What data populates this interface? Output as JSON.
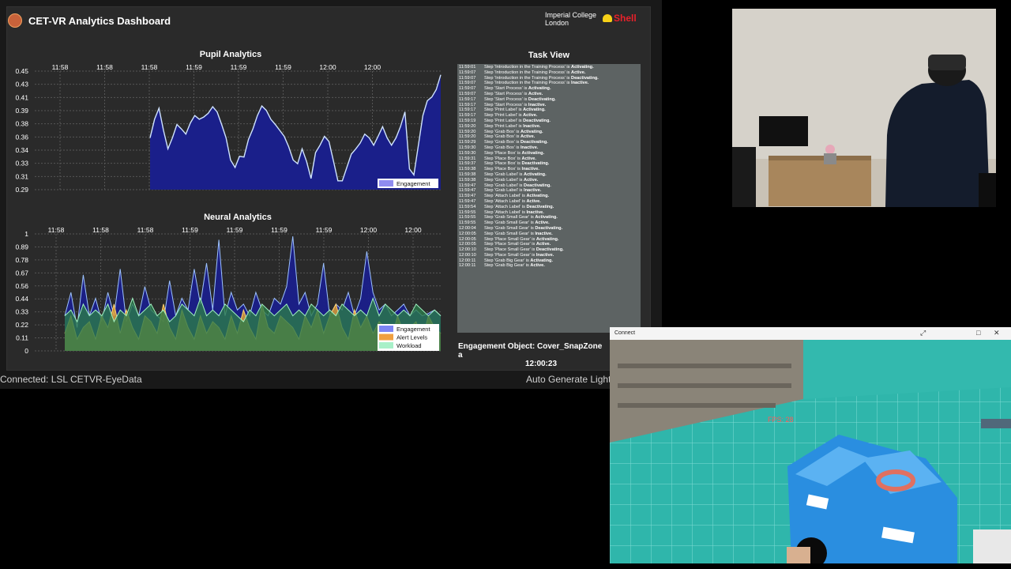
{
  "dashboard": {
    "title": "CET-VR Analytics Dashboard",
    "brand_1_line1": "Imperial College",
    "brand_1_line2": "London",
    "brand_2": "Shell",
    "status_left": "Connected: LSL CETVR-EyeData",
    "status_right": "Auto Generate Light",
    "engagement_object_label": "Engagement Object:",
    "engagement_object_value": "Cover_SnapZone a",
    "engagement_object_time": "12:00:23"
  },
  "pupil_chart": {
    "title": "Pupil Analytics",
    "x_ticks": [
      "11:58",
      "11:58",
      "11:58",
      "11:59",
      "11:59",
      "11:59",
      "12:00",
      "12:00"
    ],
    "y_ticks": [
      "0.45",
      "0.43",
      "0.41",
      "0.39",
      "0.38",
      "0.36",
      "0.34",
      "0.33",
      "0.31",
      "0.29"
    ],
    "legend": "Engagement"
  },
  "neural_chart": {
    "title": "Neural Analytics",
    "x_ticks": [
      "11:58",
      "11:58",
      "11:58",
      "11:59",
      "11:59",
      "11:59",
      "11:59",
      "12:00",
      "12:00"
    ],
    "y_ticks": [
      "1",
      "0.89",
      "0.78",
      "0.67",
      "0.56",
      "0.44",
      "0.33",
      "0.22",
      "0.11",
      "0"
    ],
    "legend": [
      "Engagement",
      "Alert Levels",
      "Workload"
    ]
  },
  "chart_data": [
    {
      "type": "area",
      "title": "Pupil Analytics",
      "ylim": [
        0.29,
        0.45
      ],
      "series": [
        {
          "name": "Engagement",
          "x": [
            0,
            1,
            2,
            3,
            4,
            5,
            6,
            7,
            8,
            9,
            10,
            11,
            12,
            13,
            14,
            15,
            16,
            17,
            18,
            19,
            20,
            21,
            22,
            23,
            24,
            25,
            26,
            27,
            28,
            29,
            30,
            31,
            32,
            33,
            34,
            35,
            36,
            37,
            38,
            39,
            40,
            41,
            42,
            43,
            44,
            45,
            46,
            47,
            48,
            49,
            50,
            51,
            52,
            53,
            54,
            55,
            56,
            57,
            58,
            59,
            60,
            61,
            62,
            63,
            64,
            65
          ],
          "values": [
            0.36,
            0.385,
            0.4,
            0.37,
            0.345,
            0.36,
            0.378,
            0.372,
            0.365,
            0.38,
            0.39,
            0.385,
            0.388,
            0.393,
            0.402,
            0.395,
            0.378,
            0.36,
            0.33,
            0.32,
            0.335,
            0.334,
            0.358,
            0.372,
            0.39,
            0.403,
            0.397,
            0.385,
            0.378,
            0.37,
            0.362,
            0.348,
            0.33,
            0.325,
            0.345,
            0.328,
            0.305,
            0.34,
            0.35,
            0.362,
            0.355,
            0.329,
            0.302,
            0.302,
            0.32,
            0.338,
            0.345,
            0.353,
            0.365,
            0.36,
            0.35,
            0.362,
            0.375,
            0.36,
            0.35,
            0.36,
            0.375,
            0.395,
            0.318,
            0.31,
            0.35,
            0.39,
            0.41,
            0.415,
            0.425,
            0.445
          ]
        }
      ]
    },
    {
      "type": "area",
      "title": "Neural Analytics",
      "ylim": [
        0,
        1
      ],
      "series": [
        {
          "name": "Engagement",
          "values": [
            0.3,
            0.5,
            0.2,
            0.65,
            0.3,
            0.45,
            0.25,
            0.5,
            0.3,
            0.7,
            0.25,
            0.4,
            0.3,
            0.55,
            0.35,
            0.3,
            0.25,
            0.6,
            0.3,
            0.45,
            0.35,
            0.7,
            0.4,
            0.75,
            0.35,
            0.95,
            0.3,
            0.5,
            0.35,
            0.4,
            0.3,
            0.5,
            0.35,
            0.3,
            0.45,
            0.4,
            0.55,
            0.98,
            0.4,
            0.5,
            0.3,
            0.4,
            0.75,
            0.3,
            0.4,
            0.35,
            0.5,
            0.3,
            0.45,
            0.85,
            0.5,
            0.35,
            0.4,
            0.3,
            0.35,
            0.4,
            0.3,
            0.35,
            0.3,
            0.32,
            0.35,
            0.3
          ]
        },
        {
          "name": "Alert Levels",
          "values": [
            0.15,
            0.3,
            0.1,
            0.2,
            0.25,
            0.1,
            0.3,
            0.2,
            0.4,
            0.15,
            0.35,
            0.2,
            0.1,
            0.3,
            0.25,
            0.15,
            0.4,
            0.2,
            0.1,
            0.35,
            0.2,
            0.1,
            0.3,
            0.15,
            0.25,
            0.2,
            0.1,
            0.3,
            0.15,
            0.35,
            0.2,
            0.1,
            0.4,
            0.2,
            0.15,
            0.3,
            0.25,
            0.2,
            0.1,
            0.3,
            0.2,
            0.35,
            0.15,
            0.3,
            0.4,
            0.2,
            0.1,
            0.35,
            0.2,
            0.3,
            0.15,
            0.25,
            0.2,
            0.1,
            0.3,
            0.15,
            0.2,
            0.25,
            0.1,
            0.3,
            0.2,
            0.15
          ]
        },
        {
          "name": "Workload",
          "values": [
            0.3,
            0.35,
            0.25,
            0.4,
            0.3,
            0.35,
            0.3,
            0.4,
            0.25,
            0.35,
            0.3,
            0.45,
            0.3,
            0.35,
            0.4,
            0.3,
            0.35,
            0.25,
            0.3,
            0.4,
            0.35,
            0.3,
            0.45,
            0.3,
            0.35,
            0.3,
            0.4,
            0.35,
            0.3,
            0.25,
            0.35,
            0.3,
            0.4,
            0.35,
            0.3,
            0.35,
            0.4,
            0.3,
            0.35,
            0.3,
            0.4,
            0.35,
            0.3,
            0.35,
            0.3,
            0.4,
            0.35,
            0.3,
            0.35,
            0.3,
            0.45,
            0.3,
            0.4,
            0.35,
            0.3,
            0.35,
            0.3,
            0.4,
            0.35,
            0.3,
            0.35,
            0.3
          ]
        }
      ]
    }
  ],
  "task_view": {
    "title": "Task View",
    "entries": [
      {
        "time": "11:59:01",
        "text": "Step 'Introduction in the Training Process' is ",
        "state": "Activating."
      },
      {
        "time": "11:59:07",
        "text": "Step 'Introduction in the Training Process' is ",
        "state": "Active."
      },
      {
        "time": "11:59:07",
        "text": "Step 'Introduction in the Training Process' is ",
        "state": "Deactivating."
      },
      {
        "time": "11:59:07",
        "text": "Step 'Introduction in the Training Process' is ",
        "state": "Inactive."
      },
      {
        "time": "11:59:07",
        "text": "Step 'Start Process' is ",
        "state": "Activating."
      },
      {
        "time": "11:59:07",
        "text": "Step 'Start Process' is ",
        "state": "Active."
      },
      {
        "time": "11:59:17",
        "text": "Step 'Start Process' is ",
        "state": "Deactivating."
      },
      {
        "time": "11:59:17",
        "text": "Step 'Start Process' is ",
        "state": "Inactive."
      },
      {
        "time": "11:59:17",
        "text": "Step 'Print Label' is ",
        "state": "Activating."
      },
      {
        "time": "11:59:17",
        "text": "Step 'Print Label' is ",
        "state": "Active."
      },
      {
        "time": "11:59:19",
        "text": "Step 'Print Label' is ",
        "state": "Deactivating."
      },
      {
        "time": "11:59:20",
        "text": "Step 'Print Label' is ",
        "state": "Inactive."
      },
      {
        "time": "11:59:20",
        "text": "Step 'Grab Box' is ",
        "state": "Activating."
      },
      {
        "time": "11:59:20",
        "text": "Step 'Grab Box' is ",
        "state": "Active."
      },
      {
        "time": "11:59:29",
        "text": "Step 'Grab Box' is ",
        "state": "Deactivating."
      },
      {
        "time": "11:59:30",
        "text": "Step 'Grab Box' is ",
        "state": "Inactive."
      },
      {
        "time": "11:59:30",
        "text": "Step 'Place Box' is ",
        "state": "Activating."
      },
      {
        "time": "11:59:31",
        "text": "Step 'Place Box' is ",
        "state": "Active."
      },
      {
        "time": "11:59:37",
        "text": "Step 'Place Box' is ",
        "state": "Deactivating."
      },
      {
        "time": "11:59:38",
        "text": "Step 'Place Box' is ",
        "state": "Inactive."
      },
      {
        "time": "11:59:38",
        "text": "Step 'Grab Label' is ",
        "state": "Activating."
      },
      {
        "time": "11:59:38",
        "text": "Step 'Grab Label' is ",
        "state": "Active."
      },
      {
        "time": "11:59:47",
        "text": "Step 'Grab Label' is ",
        "state": "Deactivating."
      },
      {
        "time": "11:59:47",
        "text": "Step 'Grab Label' is ",
        "state": "Inactive."
      },
      {
        "time": "11:59:47",
        "text": "Step 'Attach Label' is ",
        "state": "Activating."
      },
      {
        "time": "11:59:47",
        "text": "Step 'Attach Label' is ",
        "state": "Active."
      },
      {
        "time": "11:59:54",
        "text": "Step 'Attach Label' is ",
        "state": "Deactivating."
      },
      {
        "time": "11:59:55",
        "text": "Step 'Attach Label' is ",
        "state": "Inactive."
      },
      {
        "time": "11:59:55",
        "text": "Step 'Grab Small Gear' is ",
        "state": "Activating."
      },
      {
        "time": "11:59:55",
        "text": "Step 'Grab Small Gear' is ",
        "state": "Active."
      },
      {
        "time": "12:00:04",
        "text": "Step 'Grab Small Gear' is ",
        "state": "Deactivating."
      },
      {
        "time": "12:00:05",
        "text": "Step 'Grab Small Gear' is ",
        "state": "Inactive."
      },
      {
        "time": "12:00:05",
        "text": "Step 'Place Small Gear' is ",
        "state": "Activating."
      },
      {
        "time": "12:00:05",
        "text": "Step 'Place Small Gear' is ",
        "state": "Active."
      },
      {
        "time": "12:00:10",
        "text": "Step 'Place Small Gear' is ",
        "state": "Deactivating."
      },
      {
        "time": "12:00:10",
        "text": "Step 'Place Small Gear' is ",
        "state": "Inactive."
      },
      {
        "time": "12:00:11",
        "text": "Step 'Grab Big Gear' is ",
        "state": "Activating."
      },
      {
        "time": "12:00:11",
        "text": "Step 'Grab Big Gear' is ",
        "state": "Active."
      }
    ]
  },
  "connect_window": {
    "title": "Connect",
    "fps": "FPS: 28"
  },
  "colors": {
    "engagement_fill": "#1a1f8a",
    "alert_fill": "#e8a52a",
    "workload_fill": "#2a7a4a",
    "task_bg": "#5d6363"
  }
}
